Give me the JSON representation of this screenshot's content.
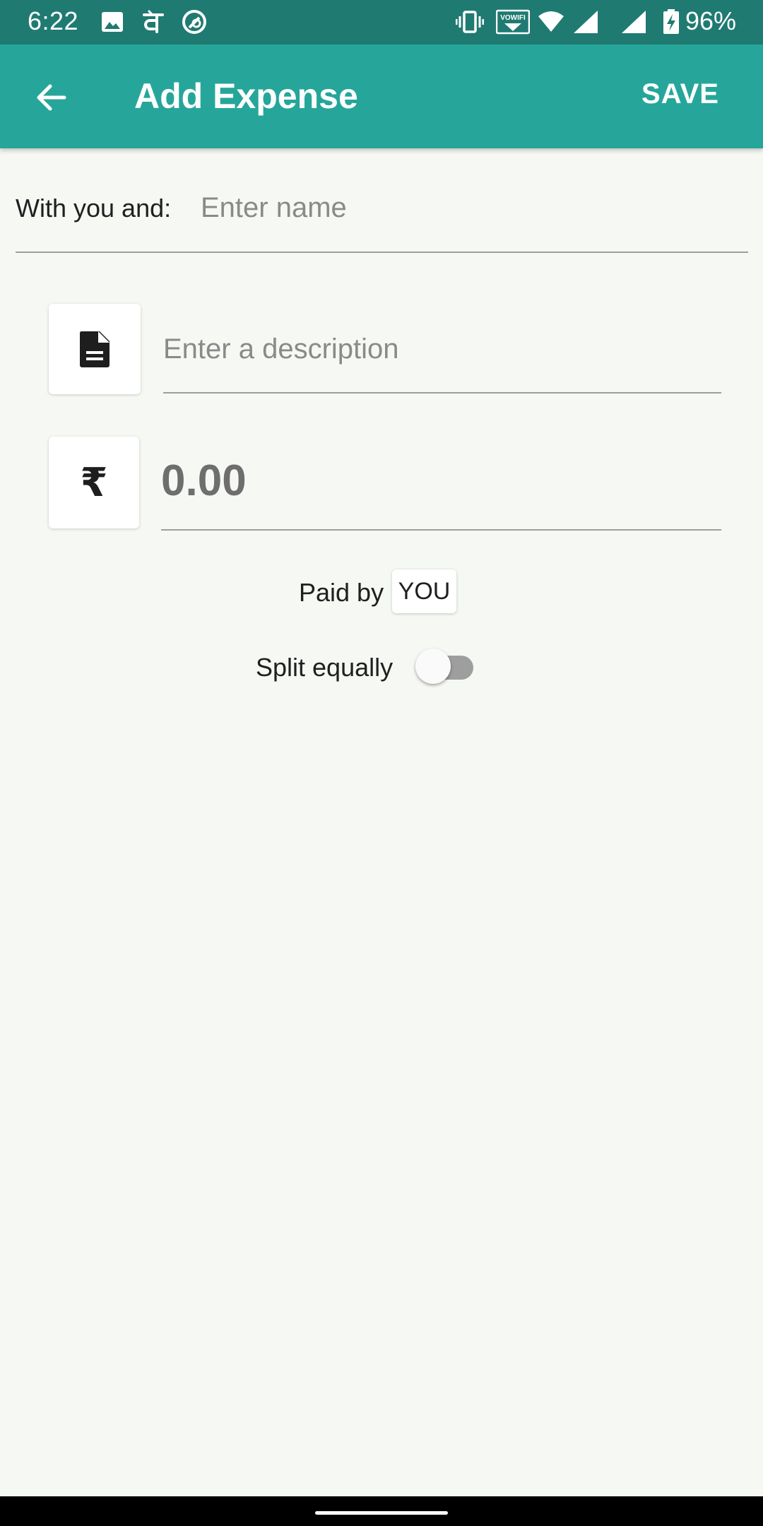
{
  "status_bar": {
    "time": "6:22",
    "battery_percent": "96%",
    "left_icons": [
      "gallery-icon",
      "phonepe-icon",
      "sync-icon"
    ],
    "right_icons": [
      "vibrate-icon",
      "vowifi-icon",
      "wifi-icon",
      "signal-icon",
      "signal-icon-2",
      "battery-charging-icon"
    ],
    "vowifi_label": "VOWIFI"
  },
  "app_bar": {
    "title": "Add Expense",
    "save_label": "SAVE",
    "back_icon": "arrow-back-icon",
    "background": "#26a69a"
  },
  "with_row": {
    "label": "With you and:",
    "name_placeholder": "Enter name"
  },
  "description": {
    "icon": "document-icon",
    "placeholder": "Enter a description"
  },
  "amount": {
    "currency_symbol": "₹",
    "placeholder": "0.00"
  },
  "paid_by": {
    "label": "Paid by",
    "payer": "YOU"
  },
  "split": {
    "label": "Split equally",
    "enabled": false
  }
}
